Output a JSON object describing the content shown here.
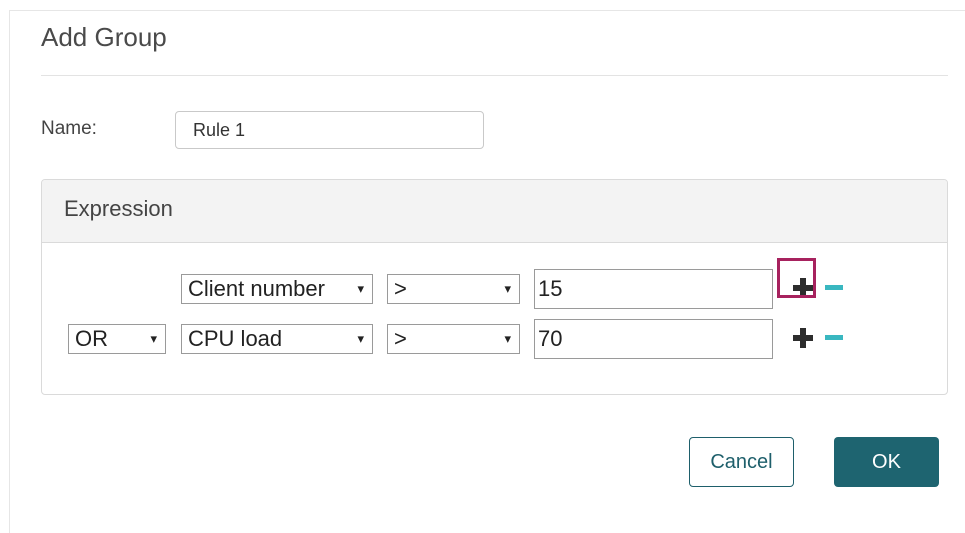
{
  "dialog": {
    "title": "Add Group"
  },
  "name": {
    "label": "Name:",
    "value": "Rule 1"
  },
  "expression": {
    "title": "Expression",
    "rows": [
      {
        "connector": "",
        "field": "Client number",
        "operator": ">",
        "value": "15"
      },
      {
        "connector": "OR",
        "field": "CPU load",
        "operator": ">",
        "value": "70"
      }
    ]
  },
  "icons": {
    "dropdown": "▾",
    "add": "plus-icon",
    "remove": "minus-icon"
  },
  "colors": {
    "accent": "#1e6470",
    "remove": "#39b7c0",
    "highlight": "#a7225e"
  },
  "buttons": {
    "cancel": "Cancel",
    "ok": "OK"
  }
}
